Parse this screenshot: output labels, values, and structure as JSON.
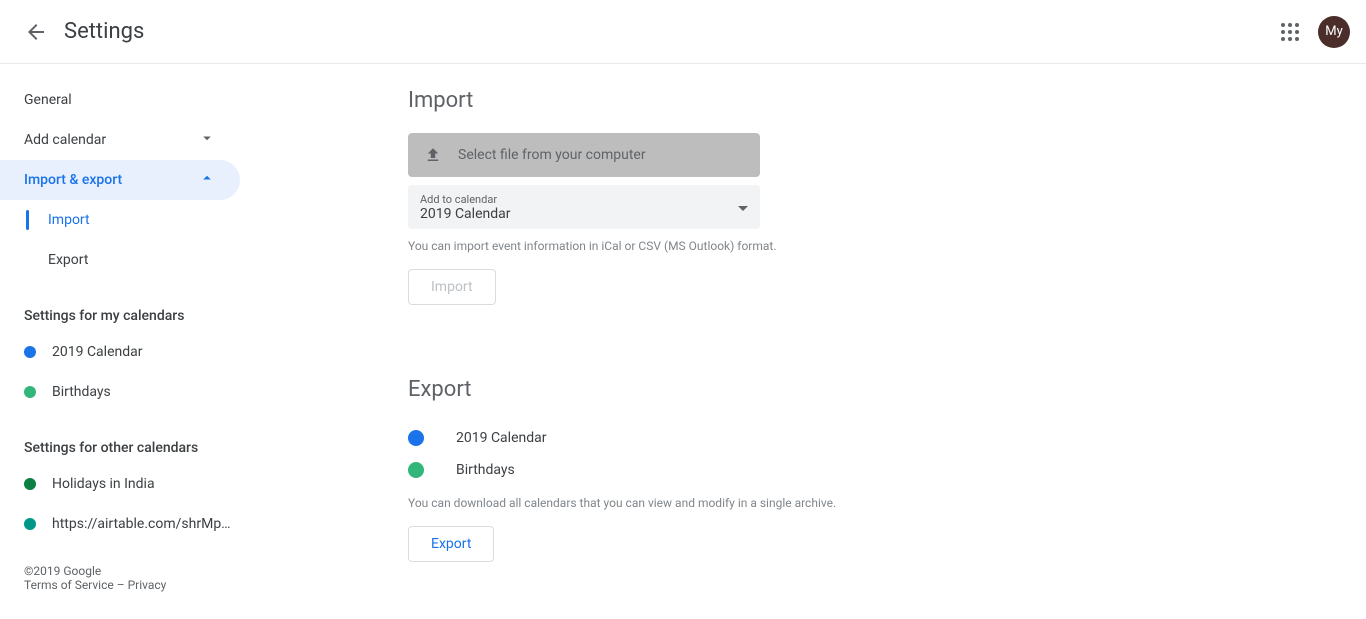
{
  "header": {
    "title": "Settings",
    "avatar": "My"
  },
  "sidebar": {
    "nav": [
      {
        "label": "General",
        "expandable": false
      },
      {
        "label": "Add calendar",
        "expandable": true
      },
      {
        "label": "Import & export",
        "expandable": true,
        "active": true
      }
    ],
    "sub": [
      {
        "label": "Import",
        "active": true
      },
      {
        "label": "Export",
        "active": false
      }
    ],
    "myCalTitle": "Settings for my calendars",
    "myCal": [
      {
        "label": "2019 Calendar",
        "color": "#1a73e8"
      },
      {
        "label": "Birthdays",
        "color": "#33b679"
      }
    ],
    "otherCalTitle": "Settings for other calendars",
    "otherCal": [
      {
        "label": "Holidays in India",
        "color": "#0b8043"
      },
      {
        "label": "https://airtable.com/shrMp…",
        "color": "#009688"
      }
    ]
  },
  "footer": {
    "copyright": "©2019 Google",
    "terms": "Terms of Service",
    "sep": " – ",
    "privacy": "Privacy"
  },
  "importPanel": {
    "title": "Import",
    "fileBtn": "Select file from your computer",
    "addToLabel": "Add to calendar",
    "addToValue": "2019 Calendar",
    "hint": "You can import event information in iCal or CSV (MS Outlook) format.",
    "importBtn": "Import"
  },
  "exportPanel": {
    "title": "Export",
    "items": [
      {
        "label": "2019 Calendar",
        "color": "#1a73e8"
      },
      {
        "label": "Birthdays",
        "color": "#33b679"
      }
    ],
    "hint": "You can download all calendars that you can view and modify in a single archive.",
    "exportBtn": "Export"
  }
}
